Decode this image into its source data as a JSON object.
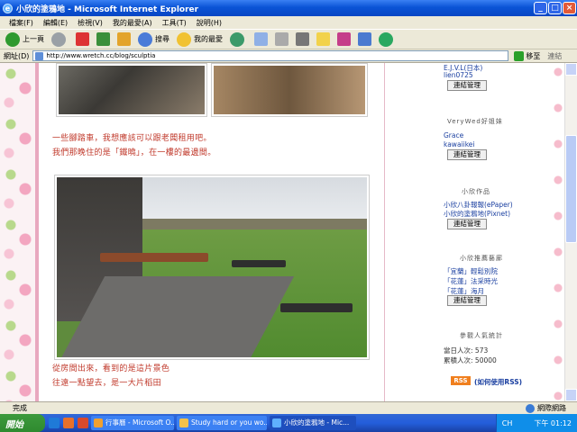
{
  "window": {
    "title": "小欣的塗鴉地 - Microsoft Internet Explorer"
  },
  "menu": [
    "檔案(F)",
    "編輯(E)",
    "檢視(V)",
    "我的最愛(A)",
    "工具(T)",
    "說明(H)"
  ],
  "toolbar": {
    "back": "上一頁",
    "search": "搜尋",
    "favorites": "我的最愛"
  },
  "address": {
    "label": "網址(D)",
    "url": "http://www.wretch.cc/blog/sculptia",
    "go": "移至",
    "links": "連結"
  },
  "content": {
    "caption1a": "一些腳踏車，我想應該可以跟老闆租用吧。",
    "caption1b": "我們那晚住的是「鐵曉」，在一樓的最邊間。",
    "caption2a": "從房間出來，看到的是這片景色",
    "caption2b": "往遠一點望去，是一大片稻田"
  },
  "sidebar": {
    "top_partial": "E.J.V.L(日本)",
    "top_link": "lien0725",
    "btn": "連結管理",
    "friends_head": "VeryWed好姐妹",
    "friends": [
      "Grace",
      "kawaiikei"
    ],
    "works_head": "小欣作品",
    "works": [
      "小欣八卦報報(ePaper)",
      "小欣的塗鴉地(Pixnet)"
    ],
    "rec_head": "小欣推薦藝廊",
    "rec": [
      "「宜蘭」輕鬆別院",
      "「花蓮」法采時光",
      "「花蓮」海月"
    ],
    "stats_head": "參觀人氣統計",
    "today_label": "當日人次: ",
    "today": "573",
    "total_label": "累積人次: ",
    "total": "50000",
    "rss_badge": "RSS",
    "rss_link": "(如何使用RSS)"
  },
  "status": {
    "left": "完成",
    "zone": "網際網路"
  },
  "taskbar": {
    "start": "開始",
    "tasks": [
      "行事曆 - Microsoft O...",
      "Study hard or you wo...",
      "小欣的塗鴉地 - Mic..."
    ],
    "lang": "CH",
    "clock": "下午 01:12"
  }
}
